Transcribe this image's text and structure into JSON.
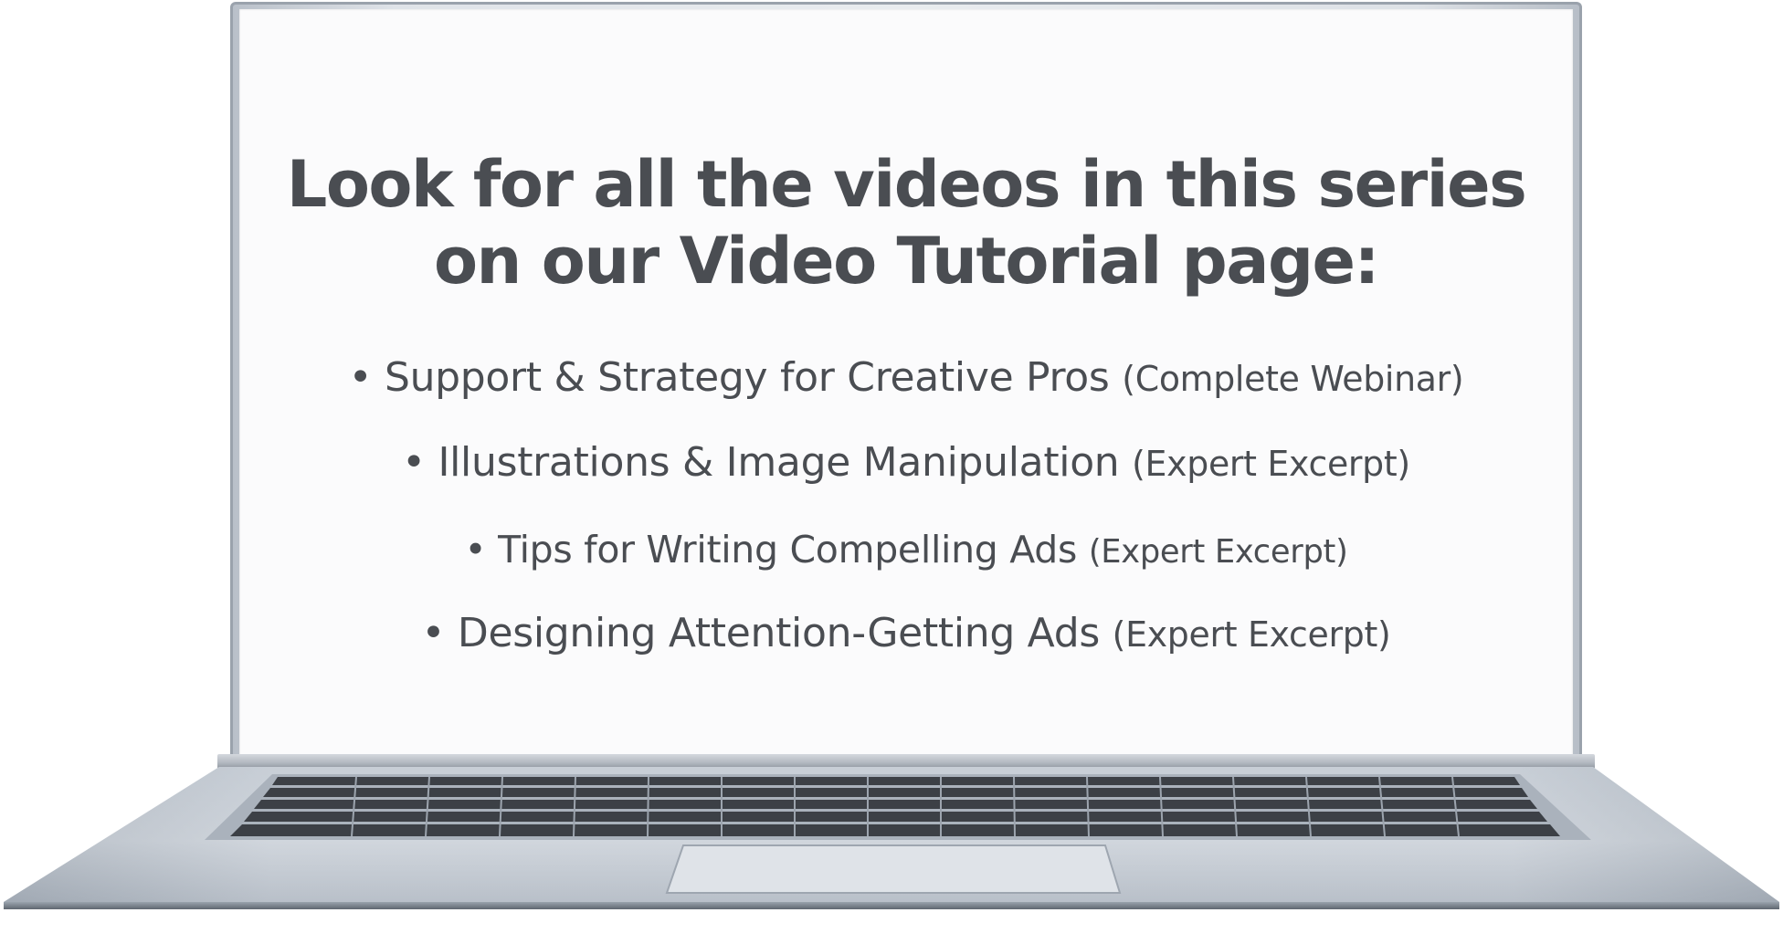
{
  "headline": {
    "line1": "Look for all the videos in this series",
    "line2": "on our Video Tutorial page:"
  },
  "videos": [
    {
      "bullet": "•",
      "title": "Support & Strategy for Creative Pros",
      "type": "(Complete Webinar)"
    },
    {
      "bullet": "•",
      "title": "Illustrations & Image Manipulation",
      "type": "(Expert Excerpt)"
    },
    {
      "bullet": "•",
      "title": "Tips for Writing Compelling Ads",
      "type": "(Expert Excerpt)"
    },
    {
      "bullet": "•",
      "title": "Designing Attention-Getting Ads",
      "type": "(Expert Excerpt)"
    }
  ],
  "colors": {
    "text": "#4a4d52",
    "screen": "#fbfbfc",
    "laptop_body": "#c3cad3",
    "keys": "#3b3f45"
  }
}
